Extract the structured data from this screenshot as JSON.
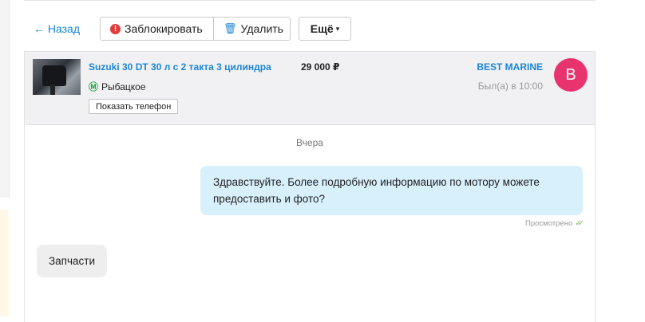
{
  "toolbar": {
    "back_label": "← Назад",
    "block_label": "Заблокировать",
    "delete_label": "Удалить",
    "more_label": "Ещё"
  },
  "item": {
    "title": "Suzuki 30 DT 30 л с 2 такта 3 цилиндра",
    "price": "29 000 ₽",
    "metro_station": "Рыбацкое",
    "show_phone_label": "Показать телефон"
  },
  "seller": {
    "name": "BEST MARINE",
    "last_seen": "Был(а) в 10:00",
    "avatar_letter": "B"
  },
  "chat": {
    "date_separator": "Вчера",
    "messages": [
      {
        "direction": "out",
        "text": "Здравствуйте. Более подробную информацию по мотору можете предоставить и фото?",
        "status": "Просмотрено"
      },
      {
        "direction": "in",
        "text": "Запчасти"
      }
    ]
  },
  "colors": {
    "accent": "#1a86d6",
    "avatar": "#e9336f",
    "outgoing_bubble": "#d8f0fc",
    "incoming_bubble": "#eeeeee",
    "metro": "#2fa84f",
    "read_check": "#7bc25a"
  },
  "icons": {
    "block": "warning-circle-icon",
    "delete": "trash-icon",
    "more": "chevron-down-icon",
    "metro": "metro-icon",
    "read": "double-check-icon"
  }
}
